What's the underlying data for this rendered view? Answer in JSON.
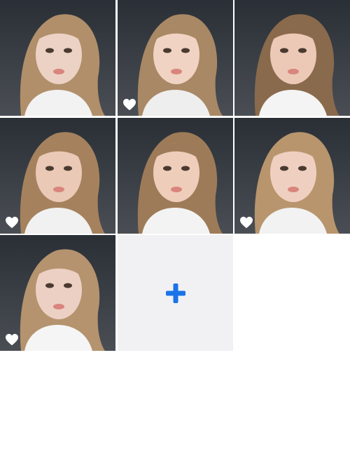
{
  "gallery": {
    "photos": [
      {
        "icon": "photo-thumbnail",
        "favorite": false,
        "bg": "#2a2f36",
        "hair": "#b08f6a",
        "face": "#ecd2c4",
        "shirt": "#f2f2f2"
      },
      {
        "icon": "photo-thumbnail",
        "favorite": true,
        "bg": "#3d3a35",
        "hair": "#a98865",
        "face": "#f0d3c2",
        "shirt": "#eeeeee"
      },
      {
        "icon": "photo-thumbnail",
        "favorite": false,
        "bg": "#4a4843",
        "hair": "#8a6a4c",
        "face": "#ecc9b6",
        "shirt": "#f4f4f4"
      },
      {
        "icon": "photo-thumbnail",
        "favorite": true,
        "bg": "#566046",
        "hair": "#a5825d",
        "face": "#eac9b6",
        "shirt": "#f1f1f1"
      },
      {
        "icon": "photo-thumbnail",
        "favorite": false,
        "bg": "#7d6a57",
        "hair": "#9e7b58",
        "face": "#efcdbb",
        "shirt": "#f3f3f3"
      },
      {
        "icon": "photo-thumbnail",
        "favorite": true,
        "bg": "#3b3f3b",
        "hair": "#b8956d",
        "face": "#efd0c0",
        "shirt": "#f2f2f2"
      },
      {
        "icon": "photo-thumbnail",
        "favorite": true,
        "bg": "#a2a7ad",
        "hair": "#b4936e",
        "face": "#ecd0c3",
        "shirt": "#f5f5f5"
      }
    ],
    "add_button": {
      "icon": "plus-icon",
      "color": "#1a73e8"
    }
  },
  "colors": {
    "background": "#ffffff",
    "add_cell_bg": "#f1f1f4",
    "heart": "#ffffff"
  }
}
